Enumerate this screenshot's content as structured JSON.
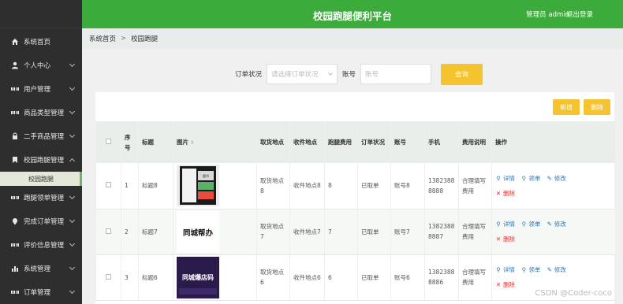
{
  "header": {
    "title": "校园跑腿便利平台",
    "admin": "管理员 admin",
    "logout": "退出登录",
    "bg_color": "#3bab3b"
  },
  "sidebar": {
    "items": [
      {
        "label": "系统首页",
        "icon": "home-icon",
        "expandable": false
      },
      {
        "label": "个人中心",
        "icon": "user-icon",
        "expandable": true
      },
      {
        "label": "用户管理",
        "icon": "grid-icon",
        "expandable": true
      },
      {
        "label": "商品类型管理",
        "icon": "grid-icon",
        "expandable": true
      },
      {
        "label": "二手商品管理",
        "icon": "lock-icon",
        "expandable": true
      },
      {
        "label": "校园跑腿管理",
        "icon": "bookmark-icon",
        "expandable": true,
        "expanded": true
      },
      {
        "label": "跑腿领单管理",
        "icon": "grid-icon",
        "expandable": true
      },
      {
        "label": "完成订单管理",
        "icon": "pin-icon",
        "expandable": true
      },
      {
        "label": "评价信息管理",
        "icon": "grid-icon",
        "expandable": true
      },
      {
        "label": "系统管理",
        "icon": "bar-chart-icon",
        "expandable": true
      },
      {
        "label": "订单管理",
        "icon": "grid-icon",
        "expandable": true
      }
    ],
    "sub_item": "校园跑腿"
  },
  "breadcrumb": {
    "home": "系统首页",
    "separator": ">",
    "current": "校园跑腿"
  },
  "search": {
    "status_label": "订单状况",
    "status_placeholder": "请选择订单状况",
    "account_label": "账号",
    "account_placeholder": "账号",
    "query_button": "查询"
  },
  "toolbar": {
    "add": "新增",
    "delete": "删除"
  },
  "table": {
    "headers": {
      "no": "序号",
      "title": "标题",
      "image": "图片",
      "pickup": "取货地点",
      "receive": "收件地点",
      "fee": "跑腿费用",
      "status": "订单状况",
      "account": "账号",
      "phone": "手机",
      "fee_desc": "费用说明",
      "actions": "操作"
    },
    "rows": [
      {
        "no": "1",
        "title": "标题8",
        "pickup": "取货地点8",
        "receive": "收件地点8",
        "fee": "8",
        "status": "已取单",
        "account": "账号8",
        "phone": "13823888888",
        "fee_desc": "合理填写费用",
        "img_text": "图书",
        "img_color": "#e8e8e8"
      },
      {
        "no": "2",
        "title": "标题7",
        "pickup": "取货地点7",
        "receive": "收件地点7",
        "fee": "7",
        "status": "已取单",
        "account": "账号7",
        "phone": "13823888887",
        "fee_desc": "合理填写费用",
        "img_text": "同城帮办",
        "img_color": "#ffffff"
      },
      {
        "no": "3",
        "title": "标题6",
        "pickup": "取货地点6",
        "receive": "收件地点6",
        "fee": "6",
        "status": "已取单",
        "account": "账号6",
        "phone": "13823888886",
        "fee_desc": "合理填写费用",
        "img_text": "同城爆店码",
        "img_color": "#2a1b4a"
      }
    ],
    "actions": {
      "detail": "详情",
      "take": "领单",
      "edit": "修改",
      "delete": "删除"
    }
  },
  "watermark": "CSDN @Coder-coco"
}
